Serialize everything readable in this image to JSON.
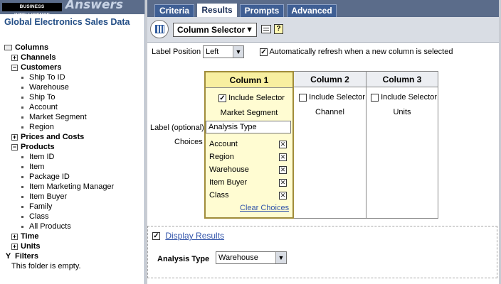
{
  "brand": {
    "logo_text": "BUSINESS INTELLIGENCE",
    "product": "Answers"
  },
  "left": {
    "subject_area": "Global Electronics Sales Data",
    "tree": [
      {
        "label": "Columns",
        "kind": "folder-root",
        "indent": 0
      },
      {
        "label": "Channels",
        "kind": "collapsed",
        "indent": 1
      },
      {
        "label": "Customers",
        "kind": "expanded",
        "indent": 1
      },
      {
        "label": "Ship To ID",
        "kind": "leaf",
        "indent": 2
      },
      {
        "label": "Warehouse",
        "kind": "leaf",
        "indent": 2
      },
      {
        "label": "Ship To",
        "kind": "leaf",
        "indent": 2
      },
      {
        "label": "Account",
        "kind": "leaf",
        "indent": 2
      },
      {
        "label": "Market Segment",
        "kind": "leaf",
        "indent": 2
      },
      {
        "label": "Region",
        "kind": "leaf",
        "indent": 2
      },
      {
        "label": "Prices and Costs",
        "kind": "collapsed",
        "indent": 1
      },
      {
        "label": "Products",
        "kind": "expanded",
        "indent": 1
      },
      {
        "label": "Item ID",
        "kind": "leaf",
        "indent": 2
      },
      {
        "label": "Item",
        "kind": "leaf",
        "indent": 2
      },
      {
        "label": "Package ID",
        "kind": "leaf",
        "indent": 2
      },
      {
        "label": "Item Marketing Manager",
        "kind": "leaf",
        "indent": 2
      },
      {
        "label": "Item Buyer",
        "kind": "leaf",
        "indent": 2
      },
      {
        "label": "Family",
        "kind": "leaf",
        "indent": 2
      },
      {
        "label": "Class",
        "kind": "leaf",
        "indent": 2
      },
      {
        "label": "All Products",
        "kind": "leaf",
        "indent": 2
      },
      {
        "label": "Time",
        "kind": "collapsed",
        "indent": 1
      },
      {
        "label": "Units",
        "kind": "collapsed",
        "indent": 1
      },
      {
        "label": "Filters",
        "kind": "filters",
        "indent": 0
      },
      {
        "label": "This folder is empty.",
        "kind": "note",
        "indent": 0
      }
    ]
  },
  "tabs": [
    {
      "label": "Criteria",
      "active": false
    },
    {
      "label": "Results",
      "active": true
    },
    {
      "label": "Prompts",
      "active": false
    },
    {
      "label": "Advanced",
      "active": false
    }
  ],
  "toolbar": {
    "view_selected": "Column Selector"
  },
  "label_position": {
    "label": "Label Position",
    "value": "Left"
  },
  "auto_refresh": {
    "checked": true,
    "label": "Automatically refresh when a new column is selected"
  },
  "selector": {
    "label_caption": "Label (optional)",
    "choices_caption": "Choices",
    "label_value": "Analysis Type",
    "columns": [
      {
        "header": "Column 1",
        "include_label": "Include Selector",
        "checked": true,
        "column_name": "Market Segment",
        "selected": true
      },
      {
        "header": "Column 2",
        "include_label": "Include Selector",
        "checked": false,
        "column_name": "Channel",
        "selected": false
      },
      {
        "header": "Column 3",
        "include_label": "Include Selector",
        "checked": false,
        "column_name": "Units",
        "selected": false
      }
    ],
    "choices": [
      "Account",
      "Region",
      "Warehouse",
      "Item Buyer",
      "Class"
    ],
    "clear_label": "Clear Choices"
  },
  "display_results": {
    "checked": true,
    "link_label": "Display Results",
    "prompt_label": "Analysis Type",
    "prompt_value": "Warehouse"
  }
}
